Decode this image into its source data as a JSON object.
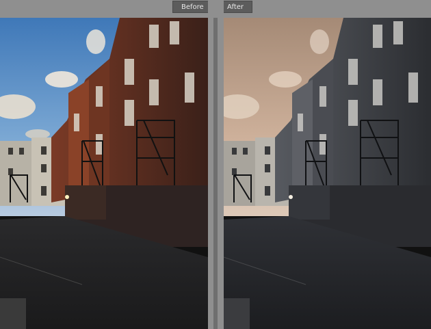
{
  "compare_view": {
    "before_label": "Before",
    "after_label": "After"
  },
  "colors": {
    "frame": "#8f8f8f",
    "label_bg": "#5c5c5c",
    "label_text": "#e8e8e8"
  },
  "panes": {
    "before": {
      "image": "alley-photo-original"
    },
    "after": {
      "image": "alley-photo-edited-warm-desaturated"
    }
  }
}
